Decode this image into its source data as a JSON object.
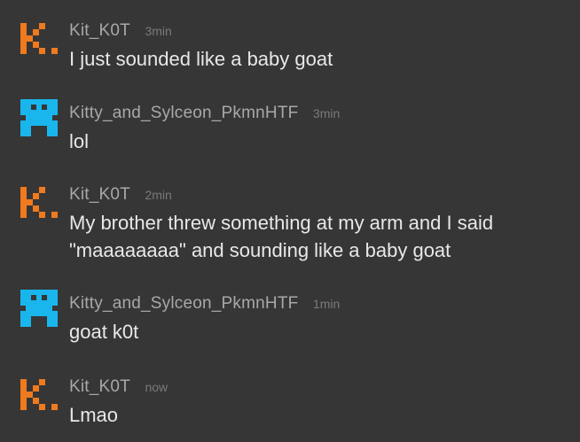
{
  "colors": {
    "background": "#363636",
    "username": "#a8a8a8",
    "timestamp": "#7a7a7a",
    "message_text": "#e8e8e8",
    "kit_avatar": "#f07a1e",
    "kitty_avatar": "#19b6ee"
  },
  "messages": [
    {
      "avatar_icon": "orange-pixel-k-avatar-icon",
      "username": "Kit_K0T",
      "time": "3min",
      "text": "I just sounded like a baby goat"
    },
    {
      "avatar_icon": "blue-pixel-avatar-icon",
      "username": "Kitty_and_Sylceon_PkmnHTF",
      "time": "3min",
      "text": "lol"
    },
    {
      "avatar_icon": "orange-pixel-k-avatar-icon",
      "username": "Kit_K0T",
      "time": "2min",
      "text": "My brother threw something at my arm and I said \"maaaaaaaa\" and sounding like a baby goat"
    },
    {
      "avatar_icon": "blue-pixel-avatar-icon",
      "username": "Kitty_and_Sylceon_PkmnHTF",
      "time": "1min",
      "text": "goat k0t"
    },
    {
      "avatar_icon": "orange-pixel-k-avatar-icon",
      "username": "Kit_K0T",
      "time": "now",
      "text": "Lmao"
    }
  ]
}
